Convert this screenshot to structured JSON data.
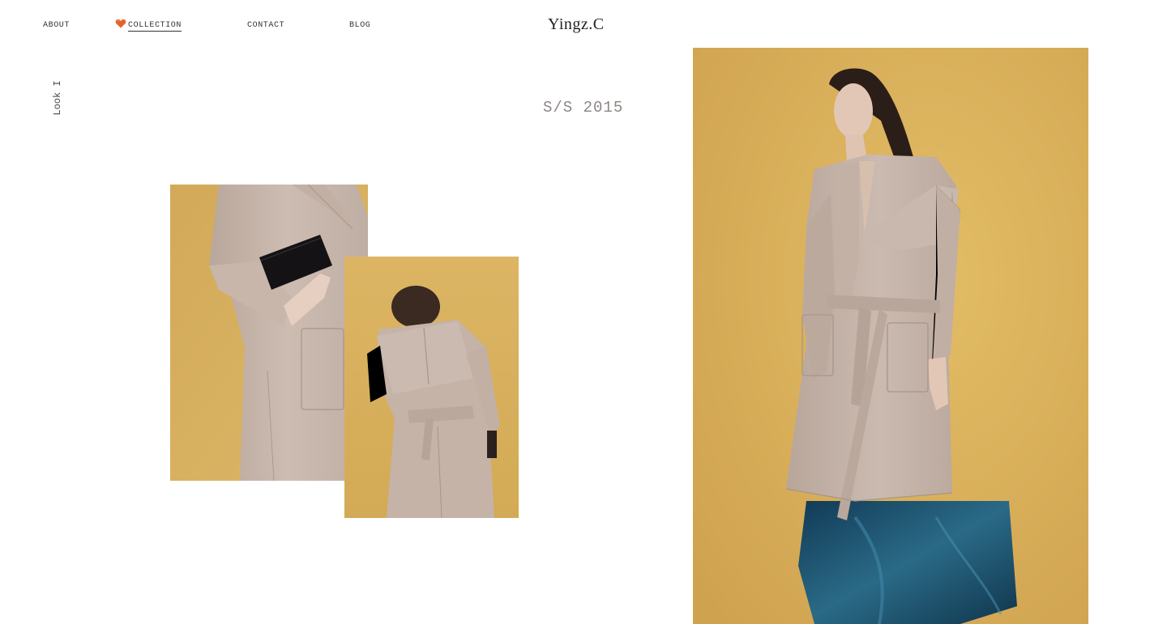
{
  "nav": {
    "items": [
      {
        "label": "ABOUT",
        "active": false
      },
      {
        "label": "COLLECTION",
        "active": true,
        "icon": "heart-icon"
      },
      {
        "label": "CONTACT",
        "active": false
      },
      {
        "label": "BLOG",
        "active": false
      }
    ]
  },
  "brand": {
    "name": "Yingz.C"
  },
  "look": {
    "label": "Look I"
  },
  "season": {
    "label": "S/S 2015"
  },
  "colors": {
    "background": "#ffffff",
    "backdrop_yellow": "#d9b25c",
    "coat_beige": "#c6b3a8",
    "heart_orange": "#e8632a",
    "season_gray": "#8c8784",
    "pants_teal": "#1d4e6b"
  },
  "photos": [
    {
      "name": "coat-front-detail-photo",
      "depicts": "model holding black clutch, beige trench coat front detail"
    },
    {
      "name": "coat-back-photo",
      "depicts": "model in beige trench coat seen from back with belt"
    },
    {
      "name": "full-look-photo",
      "depicts": "model in beige belted trench coat with teal wide-leg trousers"
    }
  ]
}
